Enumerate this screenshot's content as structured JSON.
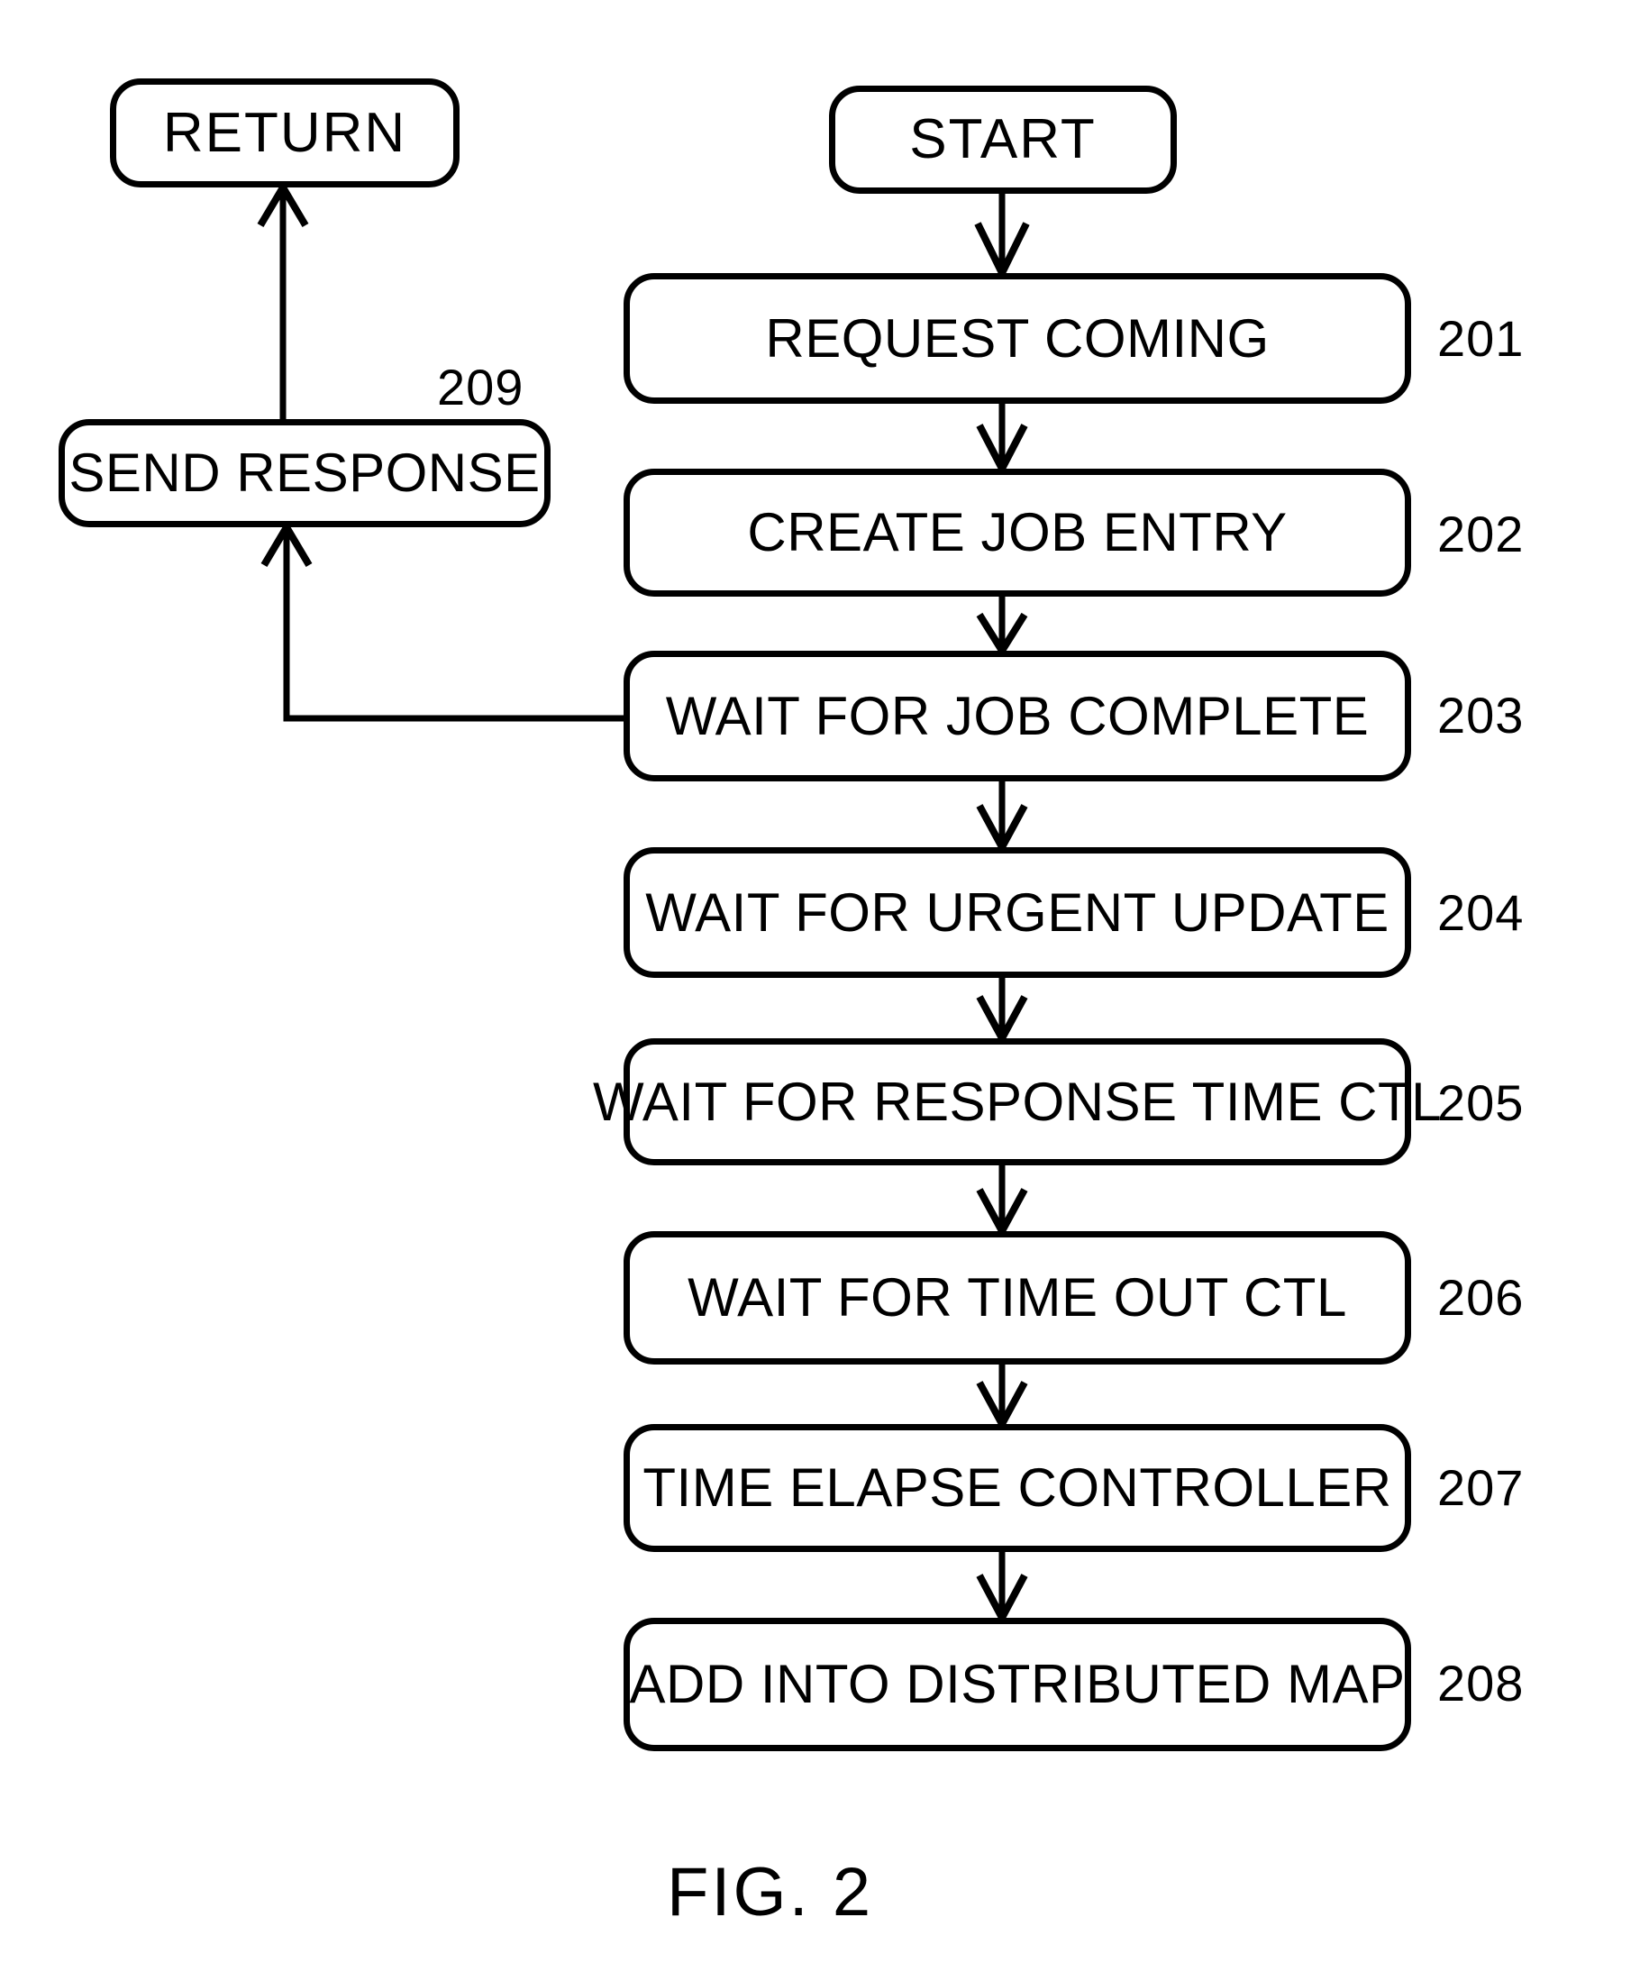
{
  "figure": {
    "caption": "FIG. 2",
    "title": "FIG. 2"
  },
  "nodes": {
    "start": {
      "label": "START",
      "kind": "terminal"
    },
    "return": {
      "label": "RETURN",
      "kind": "terminal"
    },
    "send_response": {
      "label": "SEND RESPONSE",
      "kind": "process",
      "ref": "209"
    },
    "step_201": {
      "label": "REQUEST COMING",
      "kind": "process",
      "ref": "201"
    },
    "step_202": {
      "label": "CREATE JOB ENTRY",
      "kind": "process",
      "ref": "202"
    },
    "step_203": {
      "label": "WAIT FOR JOB COMPLETE",
      "kind": "process",
      "ref": "203"
    },
    "step_204": {
      "label": "WAIT FOR URGENT UPDATE",
      "kind": "process",
      "ref": "204"
    },
    "step_205": {
      "label": "WAIT FOR RESPONSE TIME CTL",
      "kind": "process",
      "ref": "205"
    },
    "step_206": {
      "label": "WAIT FOR TIME OUT CTL",
      "kind": "process",
      "ref": "206"
    },
    "step_207": {
      "label": "TIME ELAPSE CONTROLLER",
      "kind": "process",
      "ref": "207"
    },
    "step_208": {
      "label": "ADD INTO DISTRIBUTED MAP",
      "kind": "process",
      "ref": "208"
    }
  },
  "ref_numbers": {
    "n201": "201",
    "n202": "202",
    "n203": "203",
    "n204": "204",
    "n205": "205",
    "n206": "206",
    "n207": "207",
    "n208": "208",
    "n209": "209"
  },
  "colors": {
    "stroke": "#000000",
    "background": "#ffffff",
    "text": "#000000"
  },
  "connectors": [
    {
      "from": "start",
      "to": "step_201",
      "style": "arrow-down"
    },
    {
      "from": "step_201",
      "to": "step_202",
      "style": "arrow-down"
    },
    {
      "from": "step_202",
      "to": "step_203",
      "style": "arrow-down"
    },
    {
      "from": "step_203",
      "to": "step_204",
      "style": "arrow-down"
    },
    {
      "from": "step_204",
      "to": "step_205",
      "style": "arrow-down"
    },
    {
      "from": "step_205",
      "to": "step_206",
      "style": "arrow-down"
    },
    {
      "from": "step_206",
      "to": "step_207",
      "style": "arrow-down"
    },
    {
      "from": "step_207",
      "to": "step_208",
      "style": "arrow-down"
    },
    {
      "from": "step_203",
      "to": "send_response",
      "style": "elbow-left-up-arrow"
    },
    {
      "from": "send_response",
      "to": "return",
      "style": "arrow-up"
    }
  ]
}
